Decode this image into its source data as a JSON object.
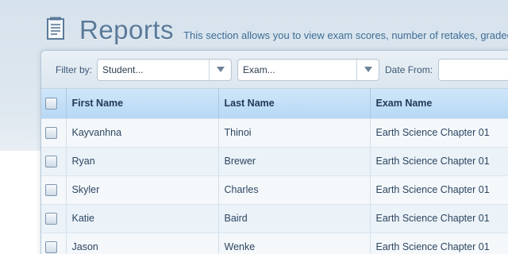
{
  "header": {
    "icon": "report-document-icon",
    "title": "Reports",
    "description": "This section allows you to view exam scores, number of retakes, graded e"
  },
  "filters": {
    "label": "Filter by:",
    "student_value": "Student...",
    "exam_value": "Exam...",
    "date_from_label": "Date From:",
    "date_from_value": ""
  },
  "table": {
    "columns": [
      "First Name",
      "Last Name",
      "Exam Name"
    ],
    "rows": [
      [
        "Kayvanhna",
        "Thinoi",
        "Earth Science Chapter 01"
      ],
      [
        "Ryan",
        "Brewer",
        "Earth Science Chapter 01"
      ],
      [
        "Skyler",
        "Charles",
        "Earth Science Chapter 01"
      ],
      [
        "Katie",
        "Baird",
        "Earth Science Chapter 01"
      ],
      [
        "Jason",
        "Wenke",
        "Earth Science Chapter 01"
      ]
    ]
  },
  "colors": {
    "title": "#5a7a9a",
    "header_row": "#c4dff6",
    "accent_text": "#3f6d96"
  }
}
